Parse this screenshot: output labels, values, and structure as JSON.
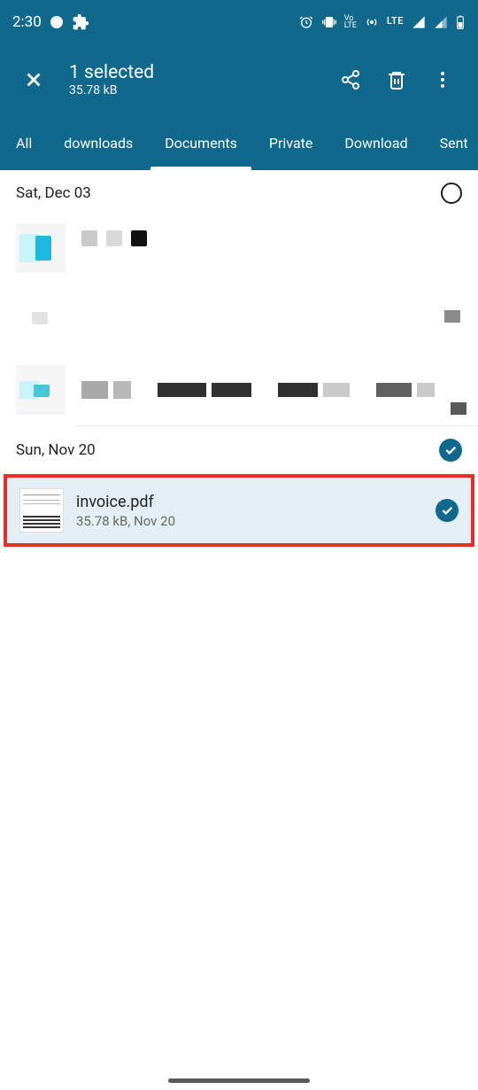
{
  "status": {
    "time": "2:30",
    "lte": "LTE"
  },
  "header": {
    "title": "1 selected",
    "subtitle": "35.78 kB"
  },
  "tabs": [
    "All",
    "downloads",
    "Documents",
    "Private",
    "Download",
    "Sent"
  ],
  "sections": [
    {
      "date": "Sat, Dec 03",
      "selected": false
    },
    {
      "date": "Sun, Nov 20",
      "selected": true
    }
  ],
  "selected_file": {
    "name": "invoice.pdf",
    "meta": "35.78 kB, Nov 20"
  }
}
